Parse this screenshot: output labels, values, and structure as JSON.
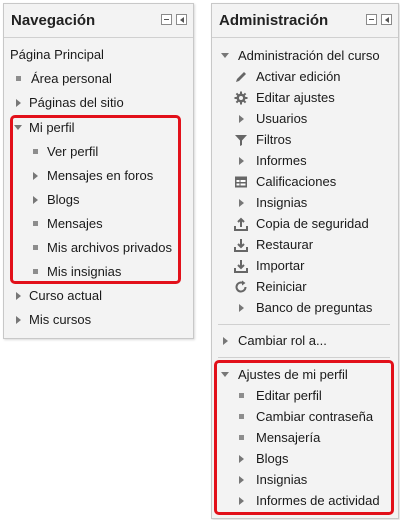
{
  "navigation": {
    "title": "Navegación",
    "home": "Página Principal",
    "area_personal": "Área personal",
    "paginas_sitio": "Páginas del sitio",
    "mi_perfil": "Mi perfil",
    "ver_perfil": "Ver perfil",
    "mensajes_foros": "Mensajes en foros",
    "blogs": "Blogs",
    "mensajes": "Mensajes",
    "mis_archivos": "Mis archivos privados",
    "mis_insignias": "Mis insignias",
    "curso_actual": "Curso actual",
    "mis_cursos": "Mis cursos"
  },
  "administration": {
    "title": "Administración",
    "course_admin": "Administración del curso",
    "activar_edicion": "Activar edición",
    "editar_ajustes": "Editar ajustes",
    "usuarios": "Usuarios",
    "filtros": "Filtros",
    "informes": "Informes",
    "calificaciones": "Calificaciones",
    "insignias": "Insignias",
    "copia_seguridad": "Copia de seguridad",
    "restaurar": "Restaurar",
    "importar": "Importar",
    "reiniciar": "Reiniciar",
    "banco_preguntas": "Banco de preguntas",
    "cambiar_rol": "Cambiar rol a...",
    "ajustes_perfil": "Ajustes de mi perfil",
    "editar_perfil": "Editar perfil",
    "cambiar_contrasena": "Cambiar contraseña",
    "mensajeria": "Mensajería",
    "blogs": "Blogs",
    "insignias2": "Insignias",
    "informes_actividad": "Informes de actividad"
  },
  "colors": {
    "highlight": "#e2101a",
    "block_bg": "#f3f3f3"
  }
}
